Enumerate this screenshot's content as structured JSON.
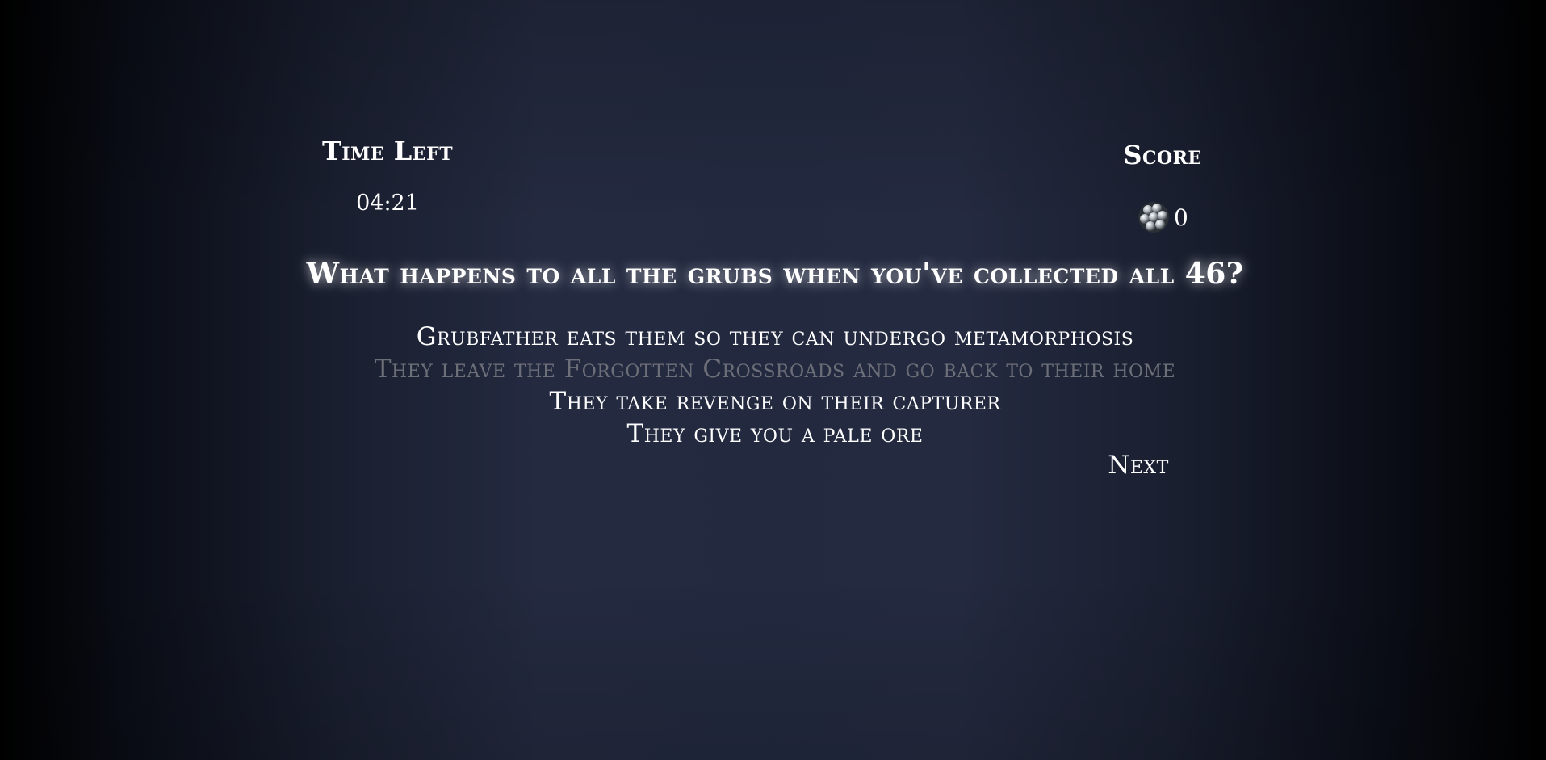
{
  "hud": {
    "time_label": "Time Left",
    "time_value": "04:21",
    "score_label": "Score",
    "score_value": "0",
    "score_icon": "grub-cluster-icon"
  },
  "question": {
    "text": "What happens to all the grubs when you've collected all 46?",
    "answers": [
      {
        "label": "Grubfather eats them so they can undergo metamorphosis",
        "state": "normal"
      },
      {
        "label": "They leave the Forgotten Crossroads and go back to their home",
        "state": "disabled"
      },
      {
        "label": "They take revenge on their capturer",
        "state": "normal"
      },
      {
        "label": "They give you a pale ore",
        "state": "normal"
      }
    ]
  },
  "controls": {
    "next_label": "Next"
  },
  "colors": {
    "background_center": "#232a40",
    "background_edge": "#000000",
    "text": "#ffffff",
    "dimmed_text": "#6d6f78"
  }
}
